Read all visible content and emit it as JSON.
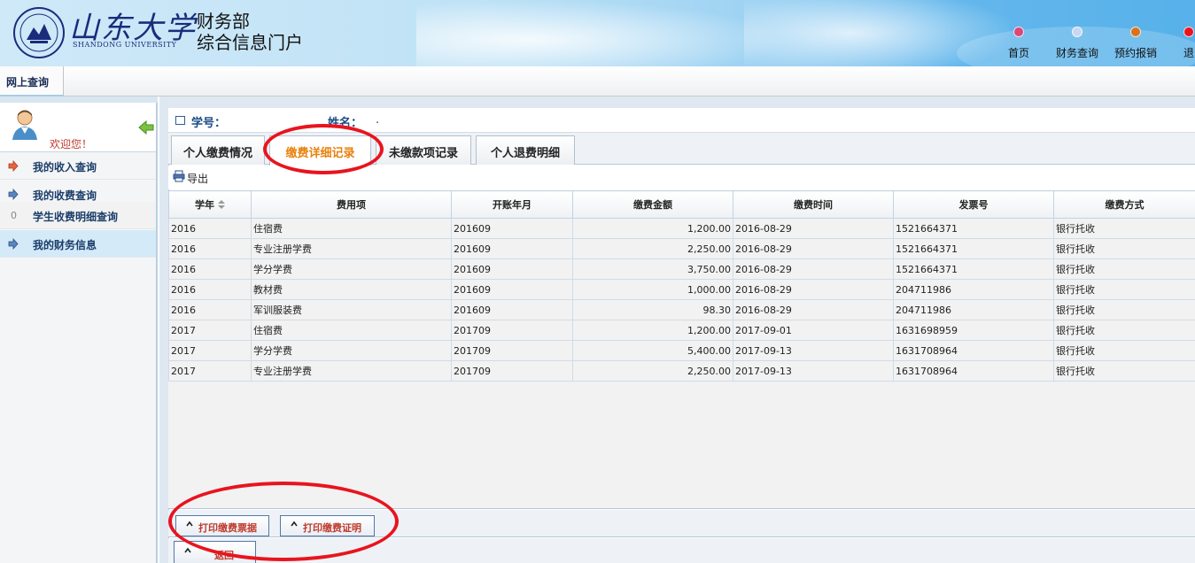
{
  "header": {
    "university_cn": "山东大学",
    "university_en": "SHANDONG UNIVERSITY",
    "portal_line1": "财务部",
    "portal_line2": "综合信息门户",
    "nav": [
      {
        "label": "首页",
        "color": "#d9477b"
      },
      {
        "label": "财务查询",
        "color": "#c8d8f0"
      },
      {
        "label": "预约报销",
        "color": "#d9721c"
      },
      {
        "label": "退",
        "color": "#e8141e"
      }
    ]
  },
  "menubar": {
    "tab": "网上查询"
  },
  "sidebar": {
    "welcome": "欢迎您！",
    "items": [
      {
        "label": "我的收入查询"
      },
      {
        "label": "我的收费查询"
      },
      {
        "label": "学生收费明细查询",
        "prefix": "0"
      },
      {
        "label": "我的财务信息"
      }
    ]
  },
  "info": {
    "student_id_label": "学号：",
    "name_label": "姓名：",
    "name_value": "."
  },
  "tabs": [
    {
      "label": "个人缴费情况"
    },
    {
      "label": "缴费详细记录"
    },
    {
      "label": "未缴款项记录"
    },
    {
      "label": "个人退费明细"
    }
  ],
  "toolbar": {
    "export": "导出"
  },
  "table": {
    "columns": [
      "学年",
      "费用项",
      "开账年月",
      "缴费金额",
      "缴费时间",
      "发票号",
      "缴费方式"
    ],
    "rows": [
      [
        "2016",
        "住宿费",
        "201609",
        "1,200.00",
        "2016-08-29",
        "1521664371",
        "银行托收"
      ],
      [
        "2016",
        "专业注册学费",
        "201609",
        "2,250.00",
        "2016-08-29",
        "1521664371",
        "银行托收"
      ],
      [
        "2016",
        "学分学费",
        "201609",
        "3,750.00",
        "2016-08-29",
        "1521664371",
        "银行托收"
      ],
      [
        "2016",
        "教材费",
        "201609",
        "1,000.00",
        "2016-08-29",
        "204711986",
        "银行托收"
      ],
      [
        "2016",
        "军训服装费",
        "201609",
        "98.30",
        "2016-08-29",
        "204711986",
        "银行托收"
      ],
      [
        "2017",
        "住宿费",
        "201709",
        "1,200.00",
        "2017-09-01",
        "1631698959",
        "银行托收"
      ],
      [
        "2017",
        "学分学费",
        "201709",
        "5,400.00",
        "2017-09-13",
        "1631708964",
        "银行托收"
      ],
      [
        "2017",
        "专业注册学费",
        "201709",
        "2,250.00",
        "2017-09-13",
        "1631708964",
        "银行托收"
      ]
    ]
  },
  "buttons": {
    "print_receipt": "打印缴费票据",
    "print_certificate": "打印缴费证明",
    "back": "返回"
  },
  "colors": {
    "accent": "#e8820c",
    "annotation": "#e8141e",
    "link": "#1a3d6a"
  }
}
